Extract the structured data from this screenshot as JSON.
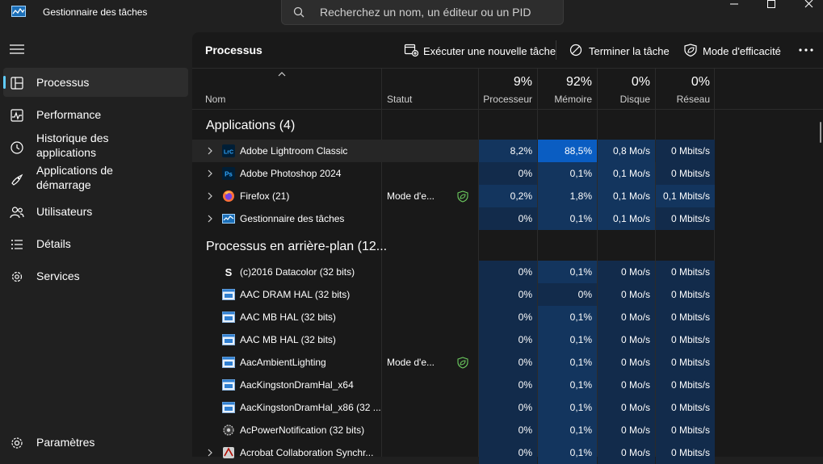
{
  "window": {
    "title": "Gestionnaire des tâches"
  },
  "search": {
    "placeholder": "Recherchez un nom, un éditeur ou un PID"
  },
  "sidebar": {
    "items": [
      {
        "label": "Processus",
        "icon": "processes-icon",
        "active": true
      },
      {
        "label": "Performance",
        "icon": "performance-icon"
      },
      {
        "label": "Historique des\napplications",
        "icon": "history-icon"
      },
      {
        "label": "Applications de\ndémarrage",
        "icon": "startup-icon"
      },
      {
        "label": "Utilisateurs",
        "icon": "users-icon"
      },
      {
        "label": "Détails",
        "icon": "details-icon"
      },
      {
        "label": "Services",
        "icon": "services-icon"
      }
    ],
    "settings": "Paramètres"
  },
  "toolbar": {
    "title": "Processus",
    "run_task": "Exécuter une nouvelle tâche",
    "end_task": "Terminer la tâche",
    "efficiency": "Mode d'efficacité"
  },
  "columns": {
    "name": "Nom",
    "status": "Statut",
    "cpu_pct": "9%",
    "cpu": "Processeur",
    "mem_pct": "92%",
    "mem": "Mémoire",
    "disk_pct": "0%",
    "disk": "Disque",
    "net_pct": "0%",
    "net": "Réseau"
  },
  "groups": {
    "apps": "Applications (4)",
    "background": "Processus en arrière-plan (12..."
  },
  "accent": "#60cdff",
  "apps": [
    {
      "name": "Adobe Lightroom Classic",
      "status": "",
      "cpu": "8,2%",
      "mem": "88,5%",
      "disk": "0,8 Mo/s",
      "net": "0 Mbits/s",
      "icon": "lightroom-icon"
    },
    {
      "name": "Adobe Photoshop 2024",
      "status": "",
      "cpu": "0%",
      "mem": "0,1%",
      "disk": "0,1 Mo/s",
      "net": "0 Mbits/s",
      "icon": "photoshop-icon"
    },
    {
      "name": "Firefox (21)",
      "status": "Mode d'e...",
      "cpu": "0,2%",
      "mem": "1,8%",
      "disk": "0,1 Mo/s",
      "net": "0,1 Mbits/s",
      "icon": "firefox-icon"
    },
    {
      "name": "Gestionnaire des tâches",
      "status": "",
      "cpu": "0%",
      "mem": "0,1%",
      "disk": "0,1 Mo/s",
      "net": "0 Mbits/s",
      "icon": "task-manager-icon"
    }
  ],
  "background": [
    {
      "name": "(c)2016 Datacolor (32 bits)",
      "status": "",
      "cpu": "0%",
      "mem": "0,1%",
      "disk": "0 Mo/s",
      "net": "0 Mbits/s",
      "icon": "datacolor-icon"
    },
    {
      "name": "AAC DRAM HAL (32 bits)",
      "status": "",
      "cpu": "0%",
      "mem": "0%",
      "disk": "0 Mo/s",
      "net": "0 Mbits/s",
      "icon": "app-window-icon"
    },
    {
      "name": "AAC MB HAL (32 bits)",
      "status": "",
      "cpu": "0%",
      "mem": "0,1%",
      "disk": "0 Mo/s",
      "net": "0 Mbits/s",
      "icon": "app-window-icon"
    },
    {
      "name": "AAC MB HAL (32 bits)",
      "status": "",
      "cpu": "0%",
      "mem": "0,1%",
      "disk": "0 Mo/s",
      "net": "0 Mbits/s",
      "icon": "app-window-icon"
    },
    {
      "name": "AacAmbientLighting",
      "status": "Mode d'e...",
      "cpu": "0%",
      "mem": "0,1%",
      "disk": "0 Mo/s",
      "net": "0 Mbits/s",
      "icon": "app-window-icon"
    },
    {
      "name": "AacKingstonDramHal_x64",
      "status": "",
      "cpu": "0%",
      "mem": "0,1%",
      "disk": "0 Mo/s",
      "net": "0 Mbits/s",
      "icon": "app-window-icon"
    },
    {
      "name": "AacKingstonDramHal_x86 (32 ...",
      "status": "",
      "cpu": "0%",
      "mem": "0,1%",
      "disk": "0 Mo/s",
      "net": "0 Mbits/s",
      "icon": "app-window-icon"
    },
    {
      "name": "AcPowerNotification (32 bits)",
      "status": "",
      "cpu": "0%",
      "mem": "0,1%",
      "disk": "0 Mo/s",
      "net": "0 Mbits/s",
      "icon": "gear-app-icon"
    },
    {
      "name": "Acrobat Collaboration Synchr...",
      "status": "",
      "cpu": "0%",
      "mem": "0,1%",
      "disk": "0 Mo/s",
      "net": "0 Mbits/s",
      "icon": "acrobat-icon"
    }
  ]
}
